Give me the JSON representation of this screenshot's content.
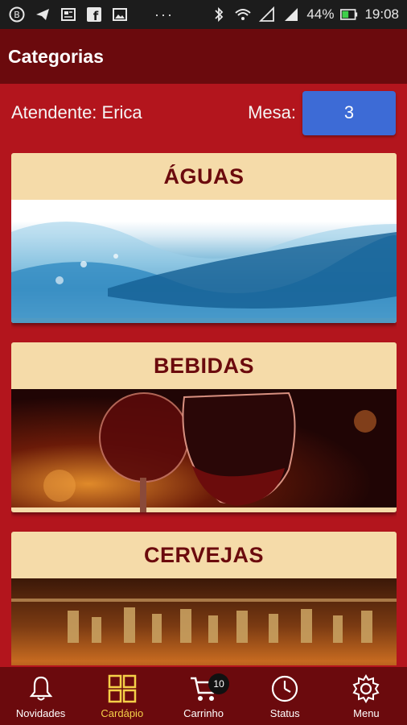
{
  "status_bar": {
    "battery": "44%",
    "time": "19:08",
    "dots": "···"
  },
  "header": {
    "title": "Categorias"
  },
  "attendant": {
    "label": "Atendente: Erica",
    "table_label": "Mesa:",
    "table_value": "3"
  },
  "categories": [
    {
      "title": "ÁGUAS",
      "image": "water-wave"
    },
    {
      "title": "BEBIDAS",
      "image": "wine-glasses"
    },
    {
      "title": "CERVEJAS",
      "image": "beer-bottles"
    }
  ],
  "bottom_nav": {
    "items": [
      {
        "label": "Novidades",
        "icon": "bell-icon"
      },
      {
        "label": "Cardápio",
        "icon": "grid-icon",
        "active": true
      },
      {
        "label": "Carrinho",
        "icon": "cart-icon",
        "badge": "10"
      },
      {
        "label": "Status",
        "icon": "clock-icon"
      },
      {
        "label": "Menu",
        "icon": "gear-icon"
      }
    ]
  },
  "colors": {
    "background": "#b3151d",
    "header": "#6b0a0d",
    "card": "#f5dba9",
    "table_box": "#3d6bd6",
    "active_nav": "#f5d048"
  }
}
